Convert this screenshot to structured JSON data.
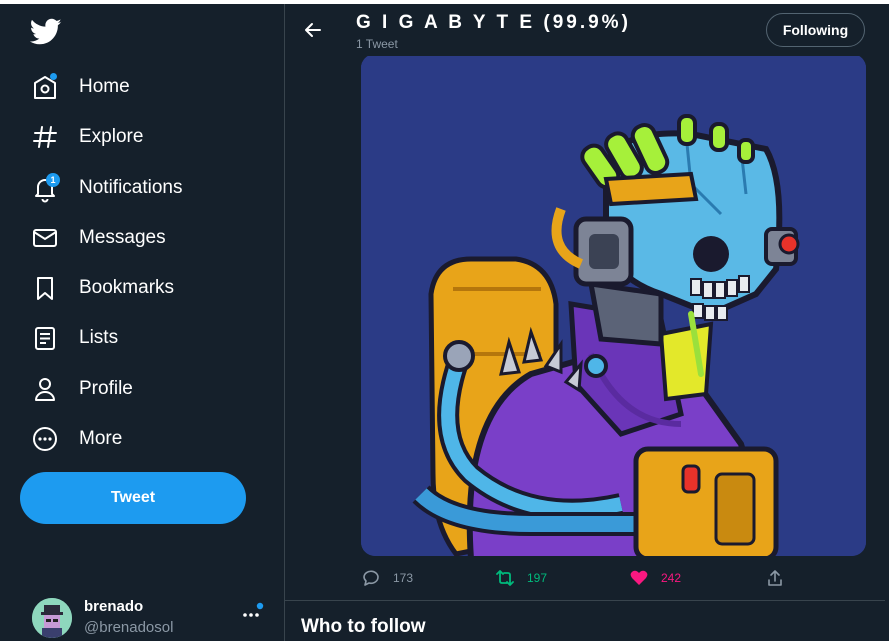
{
  "app": {
    "name": "Twitter"
  },
  "sidebar": {
    "items": [
      {
        "label": "Home",
        "icon": "home-icon"
      },
      {
        "label": "Explore",
        "icon": "hashtag-icon"
      },
      {
        "label": "Notifications",
        "icon": "bell-icon",
        "badge": "1"
      },
      {
        "label": "Messages",
        "icon": "envelope-icon"
      },
      {
        "label": "Bookmarks",
        "icon": "bookmark-icon"
      },
      {
        "label": "Lists",
        "icon": "list-icon"
      },
      {
        "label": "Profile",
        "icon": "person-icon"
      },
      {
        "label": "More",
        "icon": "more-circle-icon"
      }
    ],
    "tweet_button": "Tweet",
    "account": {
      "name": "brenado",
      "handle": "@brenadosol"
    }
  },
  "header": {
    "title": "G I G A B Y T E (99.9%)",
    "subtitle": "1 Tweet",
    "follow_button": "Following"
  },
  "tweet": {
    "replies": "173",
    "retweets": "197",
    "likes": "242"
  },
  "who_to_follow": {
    "title": "Who to follow"
  },
  "colors": {
    "background": "#15202b",
    "accent": "#1d9bf0",
    "retweet": "#00ba7c",
    "like": "#f91880",
    "muted": "#8b98a5",
    "image_background": "#2b3b86"
  }
}
